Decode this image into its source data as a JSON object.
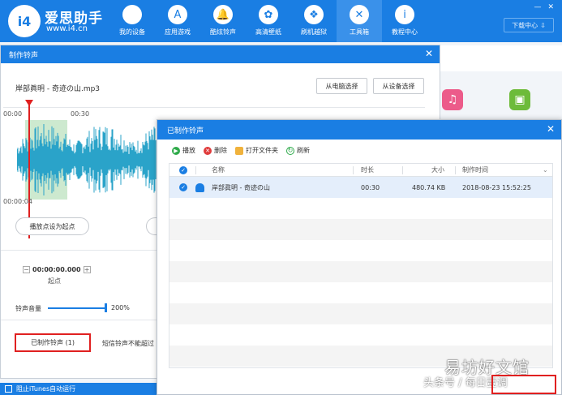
{
  "app": {
    "logo_text": "i4",
    "name": "爱思助手",
    "url": "www.i4.cn",
    "download_center": "下载中心",
    "status_text": "阻止iTunes自动运行"
  },
  "nav": [
    {
      "label": "我的设备",
      "icon": "apple-icon",
      "glyph": ""
    },
    {
      "label": "应用游戏",
      "icon": "app-store-icon",
      "glyph": "A"
    },
    {
      "label": "酷炫铃声",
      "icon": "bell-icon",
      "glyph": "🔔"
    },
    {
      "label": "高清壁纸",
      "icon": "flower-icon",
      "glyph": "✿"
    },
    {
      "label": "刷机越狱",
      "icon": "box-icon",
      "glyph": "❖"
    },
    {
      "label": "工具箱",
      "icon": "tools-icon",
      "glyph": "✕"
    },
    {
      "label": "教程中心",
      "icon": "info-icon",
      "glyph": "i"
    }
  ],
  "ringtone_maker": {
    "title": "制作铃声",
    "file_name": "岸部眞明 - 奇迹の山.mp3",
    "from_pc": "从电脑选择",
    "from_device": "从设备选择",
    "time_start": "00:00",
    "time_30": "00:30",
    "time_current": "00:00:04",
    "set_start": "播放点设为起点",
    "start_time": "00:00:00.000",
    "start_label": "起点",
    "volume_label": "铃声音量",
    "volume_value": "200%",
    "volume_level": 1.0,
    "made_button": "已制作铃声 (1)",
    "sms_note": "短信铃声不能超过"
  },
  "made_dialog": {
    "title": "已制作铃声",
    "toolbar": {
      "play": "播放",
      "delete": "删除",
      "open_folder": "打开文件夹",
      "refresh": "刷新"
    },
    "columns": {
      "name": "名称",
      "duration": "时长",
      "size": "大小",
      "created": "制作时间"
    },
    "rows": [
      {
        "name": "岸部眞明 - 奇迹の山",
        "duration": "00:30",
        "size": "480.74 KB",
        "created": "2018-08-23 15:52:25"
      }
    ]
  },
  "watermark": {
    "line1": "易坊好文馆",
    "line2": "头条号 / 每日壹调"
  },
  "colors": {
    "brand": "#1a7ee3",
    "highlight_box": "#e02020",
    "waveform": "#2aa3c9"
  }
}
